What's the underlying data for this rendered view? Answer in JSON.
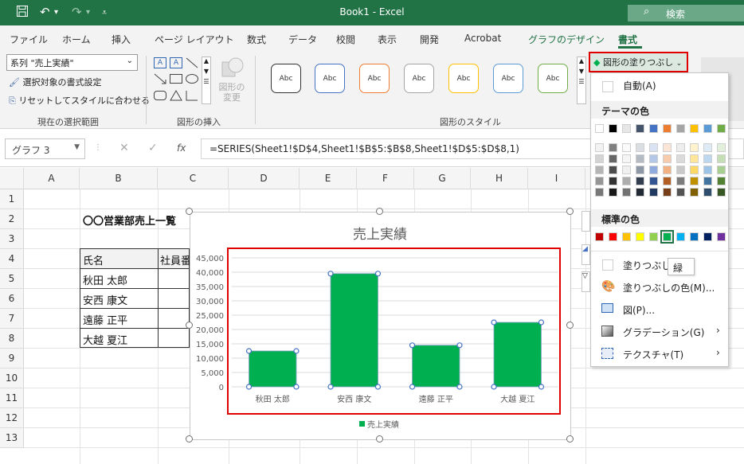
{
  "titlebar": {
    "document_title": "Book1  -  Excel",
    "search_label": "検索"
  },
  "tabs": [
    "ファイル",
    "ホーム",
    "挿入",
    "ページ レイアウト",
    "数式",
    "データ",
    "校閲",
    "表示",
    "開発",
    "Acrobat",
    "グラフのデザイン",
    "書式"
  ],
  "ribbon": {
    "selection_dropdown": "系列 \"売上実績\"",
    "format_selection": "選択対象の書式設定",
    "reset_style": "リセットしてスタイルに合わせる",
    "group_selection": "現在の選択範囲",
    "group_insert_shapes": "図形の挿入",
    "change_shape_line1": "図形の",
    "change_shape_line2": "変更",
    "group_shape_styles": "図形のスタイル",
    "style_sample_label": "Abc",
    "shape_fill_button": "図形の塗りつぶし"
  },
  "formula_bar": {
    "name_box": "グラフ 3",
    "fx": "fx",
    "formula": "=SERIES(Sheet1!$D$4,Sheet1!$B$5:$B$8,Sheet1!$D$5:$D$8,1)"
  },
  "columns": [
    "A",
    "B",
    "C",
    "D",
    "E",
    "F",
    "G",
    "H",
    "I"
  ],
  "rows": [
    "1",
    "2",
    "3",
    "4",
    "5",
    "6",
    "7",
    "8",
    "9",
    "10",
    "11",
    "12",
    "13"
  ],
  "sheet": {
    "title_cell": "〇〇営業部売上一覧",
    "header_name": "氏名",
    "header_id": "社員番",
    "names": [
      "秋田 太郎",
      "安西 康文",
      "遠藤 正平",
      "大越 夏江"
    ]
  },
  "fill_menu": {
    "auto": "自動(A)",
    "theme_colors": "テーマの色",
    "standard_colors": "標準の色",
    "no_fill": "塗りつぶしな",
    "tooltip": "緑",
    "more_colors": "塗りつぶしの色(M)...",
    "picture": "図(P)...",
    "gradient": "グラデーション(G)",
    "texture": "テクスチャ(T)",
    "theme_top": [
      "#ffffff",
      "#000000",
      "#e7e6e6",
      "#44546a",
      "#4472c4",
      "#ed7d31",
      "#a5a5a5",
      "#ffc000",
      "#5b9bd5",
      "#70ad47"
    ],
    "standard": [
      "#c00000",
      "#ff0000",
      "#ffc000",
      "#ffff00",
      "#92d050",
      "#00b050",
      "#00b0f0",
      "#0070c0",
      "#002060",
      "#7030a0"
    ]
  },
  "chart_data": {
    "type": "bar",
    "title": "売上実績",
    "categories": [
      "秋田 太郎",
      "安西 康文",
      "遠藤 正平",
      "大越 夏江"
    ],
    "series": [
      {
        "name": "売上実績",
        "values": [
          12500,
          39500,
          14500,
          22500
        ],
        "color": "#00b050"
      }
    ],
    "ylim": [
      0,
      45000
    ],
    "yticks": [
      "45,000",
      "40,000",
      "35,000",
      "30,000",
      "25,000",
      "20,000",
      "15,000",
      "10,000",
      "5,000",
      "0"
    ],
    "grid": true,
    "legend": "bottom"
  }
}
